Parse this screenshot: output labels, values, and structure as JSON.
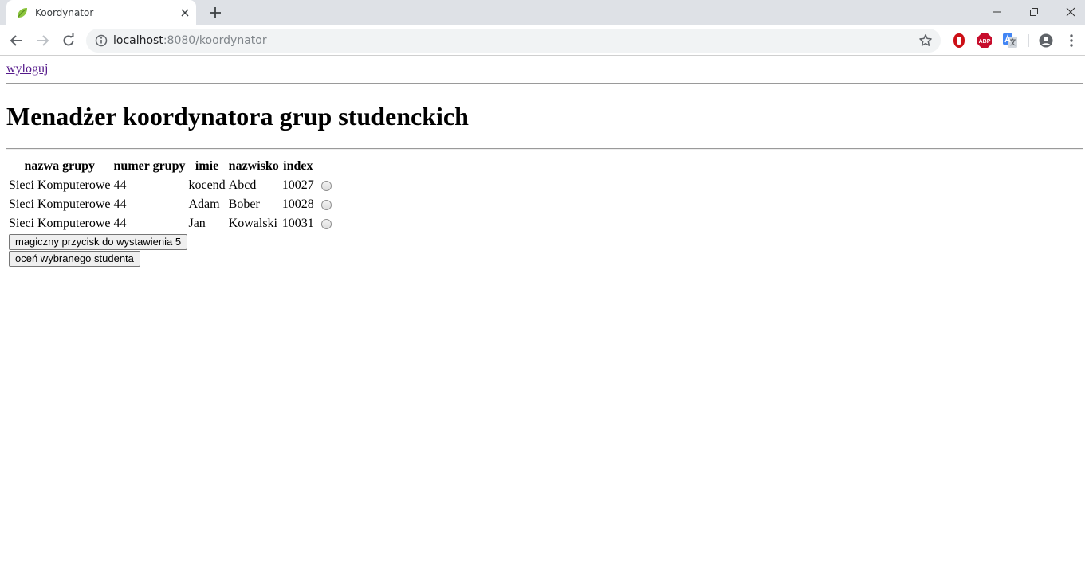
{
  "browser": {
    "tab": {
      "title": "Koordynator"
    },
    "url": {
      "host": "localhost",
      "rest": ":8080/koordynator"
    },
    "extensions": [
      "opera-ad-blocker-icon",
      "adblock-plus-icon",
      "google-translate-icon"
    ],
    "extension_labels": {
      "abp": "ABP"
    }
  },
  "page": {
    "logout_link": "wyloguj",
    "heading": "Menadżer koordynatora grup studenckich",
    "table": {
      "headers": [
        "nazwa grupy",
        "numer grupy",
        "imie",
        "nazwisko",
        "index"
      ],
      "rows": [
        [
          "Sieci Komputerowe",
          "44",
          "kocend",
          "Abcd",
          "10027"
        ],
        [
          "Sieci Komputerowe",
          "44",
          "Adam",
          "Bober",
          "10028"
        ],
        [
          "Sieci Komputerowe",
          "44",
          "Jan",
          "Kowalski",
          "10031"
        ]
      ]
    },
    "buttons": {
      "magic": "magiczny przycisk do wystawienia 5",
      "grade": "oceń wybranego studenta"
    }
  },
  "colors": {
    "tabbar_bg": "#dee1e6",
    "omnibox_bg": "#f1f3f4",
    "visited_link": "#551a8b"
  }
}
